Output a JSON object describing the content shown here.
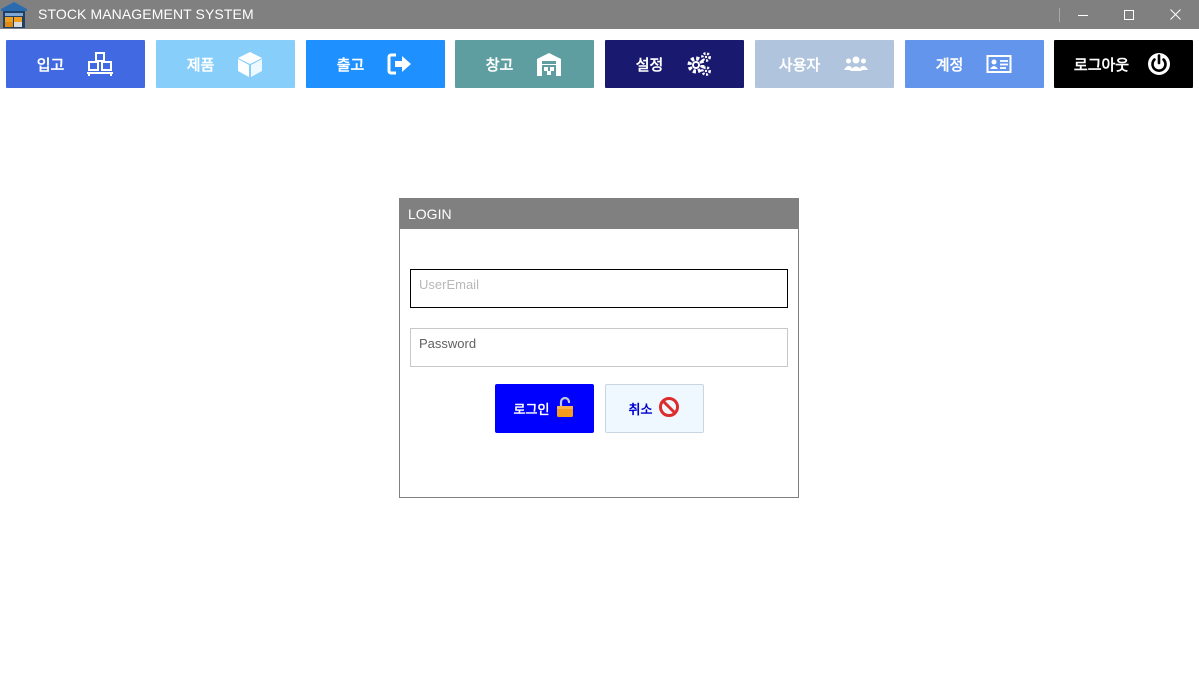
{
  "window": {
    "title": "STOCK MANAGEMENT SYSTEM",
    "titlebar_color": "#808080"
  },
  "toolbar": {
    "buttons": [
      {
        "label": "입고",
        "icon": "receiving-boxes-icon",
        "color": "#4169e1"
      },
      {
        "label": "제품",
        "icon": "product-cube-icon",
        "color": "#87cefa"
      },
      {
        "label": "출고",
        "icon": "sign-out-arrow-icon",
        "color": "#1e90ff"
      },
      {
        "label": "창고",
        "icon": "warehouse-icon",
        "color": "#5f9ea0"
      },
      {
        "label": "설정",
        "icon": "gears-icon",
        "color": "#191970"
      },
      {
        "label": "사용자",
        "icon": "users-icon",
        "color": "#b0c4de"
      },
      {
        "label": "계정",
        "icon": "id-card-icon",
        "color": "#6495ed"
      },
      {
        "label": "로그아웃",
        "icon": "power-icon",
        "color": "#000000"
      }
    ]
  },
  "login": {
    "header": "LOGIN",
    "email_placeholder": "UserEmail",
    "password_placeholder": "Password",
    "login_label": "로그인",
    "login_icon": "unlocked-padlock-icon",
    "cancel_label": "취소",
    "cancel_icon": "prohibited-icon"
  }
}
